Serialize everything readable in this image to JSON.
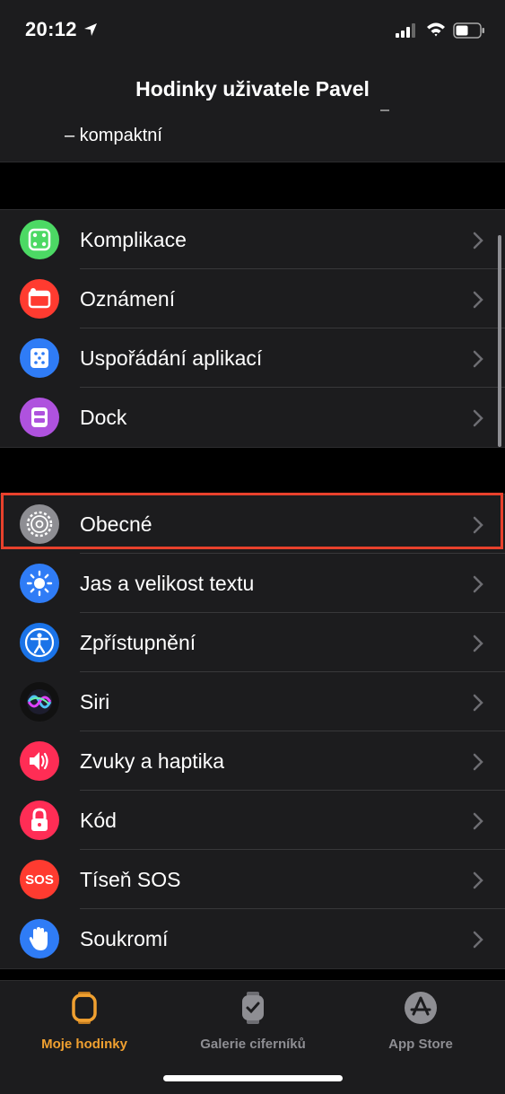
{
  "status": {
    "time": "20:12"
  },
  "nav": {
    "title": "Hodinky uživatele Pavel"
  },
  "fragment": {
    "text": "– kompaktní"
  },
  "group1": [
    {
      "label": "Komplikace",
      "icon": "complications-icon",
      "color": "#4cd964"
    },
    {
      "label": "Oznámení",
      "icon": "notifications-icon",
      "color": "#ff3b30"
    },
    {
      "label": "Uspořádání aplikací",
      "icon": "app-layout-icon",
      "color": "#2f7cf6"
    },
    {
      "label": "Dock",
      "icon": "dock-icon",
      "color": "#af52de"
    }
  ],
  "group2": [
    {
      "label": "Obecné",
      "icon": "gear-icon",
      "color": "#8e8e93"
    },
    {
      "label": "Jas a velikost textu",
      "icon": "brightness-icon",
      "color": "#2f7cf6"
    },
    {
      "label": "Zpřístupnění",
      "icon": "accessibility-icon",
      "color": "#1a73e8"
    },
    {
      "label": "Siri",
      "icon": "siri-icon",
      "color": "#111111"
    },
    {
      "label": "Zvuky a haptika",
      "icon": "speaker-icon",
      "color": "#ff2d55"
    },
    {
      "label": "Kód",
      "icon": "lock-icon",
      "color": "#ff2d55"
    },
    {
      "label": "Tíseň SOS",
      "icon": "sos-icon",
      "color": "#ff3b30",
      "icon_text": "SOS"
    },
    {
      "label": "Soukromí",
      "icon": "privacy-hand-icon",
      "color": "#2f7cf6"
    }
  ],
  "tabs": [
    {
      "label": "Moje hodinky",
      "icon": "watch-icon",
      "active": true
    },
    {
      "label": "Galerie ciferníků",
      "icon": "face-gallery-icon",
      "active": false
    },
    {
      "label": "App Store",
      "icon": "app-store-icon",
      "active": false
    }
  ],
  "accent": "#f0a030",
  "highlight_color": "#e8412c"
}
